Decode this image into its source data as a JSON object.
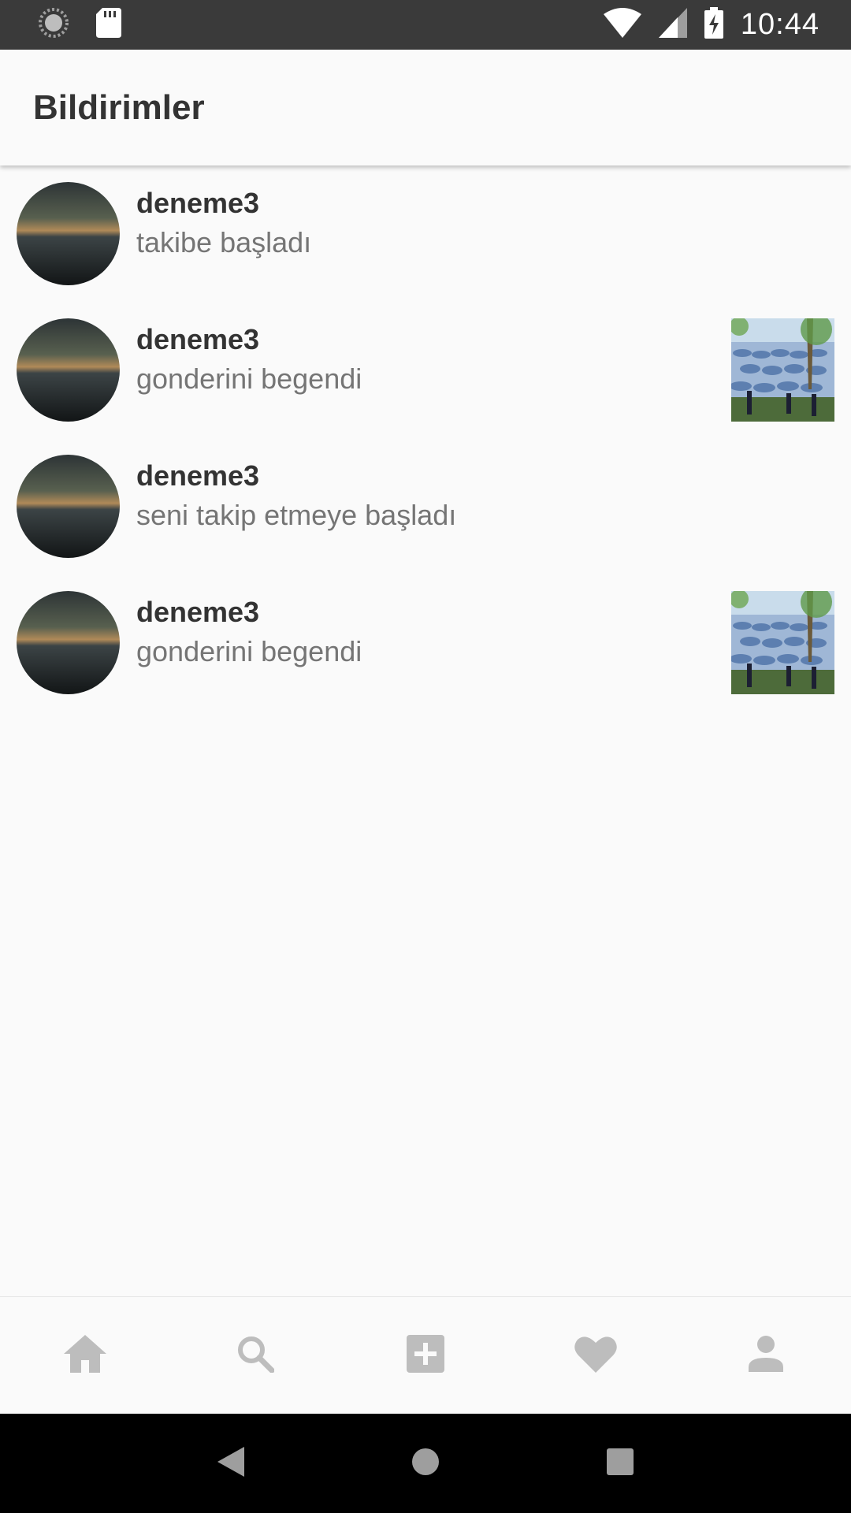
{
  "status_bar": {
    "time": "10:44",
    "icons": [
      "loading-icon",
      "sd-card-icon",
      "wifi-icon",
      "signal-icon",
      "battery-charging-icon"
    ]
  },
  "app_bar": {
    "title": "Bildirimler"
  },
  "notifications": [
    {
      "username": "deneme3",
      "message": "takibe başladı",
      "has_thumbnail": false
    },
    {
      "username": "deneme3",
      "message": "gonderini begendi",
      "has_thumbnail": true
    },
    {
      "username": "deneme3",
      "message": "seni takip etmeye başladı",
      "has_thumbnail": false
    },
    {
      "username": "deneme3",
      "message": "gonderini begendi",
      "has_thumbnail": true
    }
  ],
  "bottom_nav": {
    "items": [
      "home-icon",
      "search-icon",
      "add-post-icon",
      "heart-icon",
      "profile-icon"
    ],
    "icon_color": "#bdbdbd"
  },
  "system_nav": [
    "back-icon",
    "home-circle-icon",
    "recents-icon"
  ]
}
